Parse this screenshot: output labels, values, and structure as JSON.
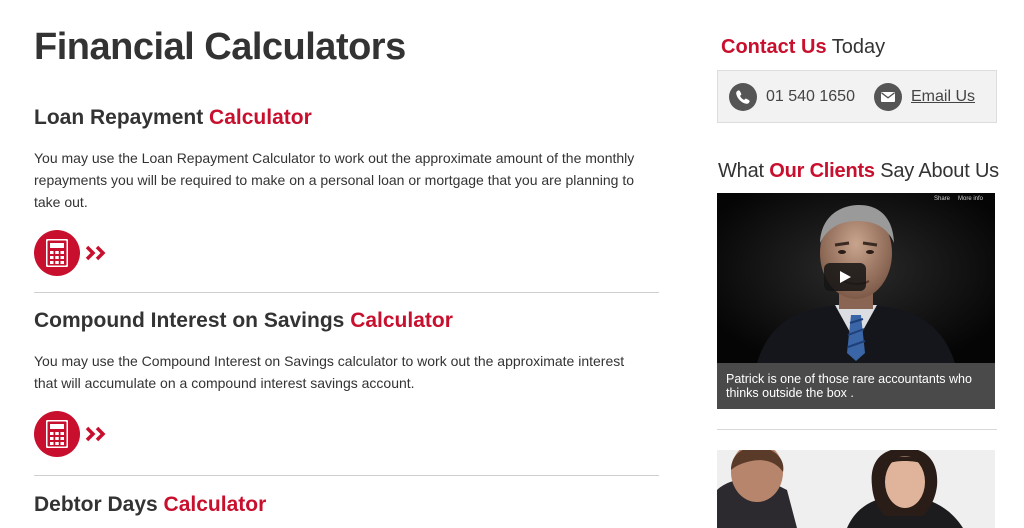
{
  "page": {
    "title": "Financial Calculators"
  },
  "calculators": [
    {
      "name": "Loan Repayment",
      "accent": "Calculator",
      "description": "You may use the Loan Repayment Calculator to work out the approximate amount of the monthly repayments you will be required to make on a personal loan or mortgage that you are planning to take out.",
      "icon": "calculator-icon"
    },
    {
      "name": "Compound Interest on Savings",
      "accent": "Calculator",
      "description": "You may use the Compound Interest on Savings calculator to work out the approximate interest that will accumulate on a compound interest savings account.",
      "icon": "calculator-icon"
    },
    {
      "name": "Debtor Days",
      "accent": "Calculator"
    }
  ],
  "sidebar": {
    "contact": {
      "title_accent": "Contact Us",
      "title_rest": "Today",
      "phone": "01 540 1650",
      "email_label": "Email Us",
      "phone_icon": "phone-icon",
      "email_icon": "envelope-icon"
    },
    "clients": {
      "title_pre": "What",
      "title_accent": "Our Clients",
      "title_rest": "Say About Us"
    },
    "video": {
      "share_label": "Share",
      "more_info_label": "More info",
      "caption": "Patrick is one of those rare accountants who thinks outside the box ."
    }
  },
  "colors": {
    "accent": "#c8102e",
    "text": "#333333",
    "contact_bg": "#f2f2f2",
    "caption_bg": "#4a4a4a"
  }
}
